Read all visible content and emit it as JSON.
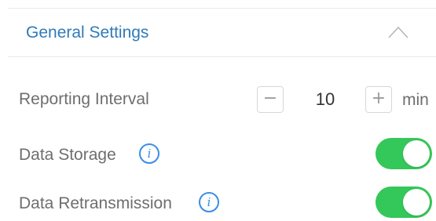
{
  "section": {
    "title": "General Settings",
    "collapse_icon": "chevron-up-icon"
  },
  "reporting_interval": {
    "label": "Reporting Interval",
    "minus_label": "−",
    "value": "10",
    "plus_label": "+",
    "unit": "min"
  },
  "data_storage": {
    "label": "Data Storage",
    "info_icon": "i",
    "enabled": true
  },
  "data_retransmission": {
    "label": "Data Retransmission",
    "info_icon": "i",
    "enabled": true
  },
  "colors": {
    "title_blue": "#2f7ab9",
    "info_blue": "#3a8ee6",
    "toggle_green": "#34c759"
  }
}
